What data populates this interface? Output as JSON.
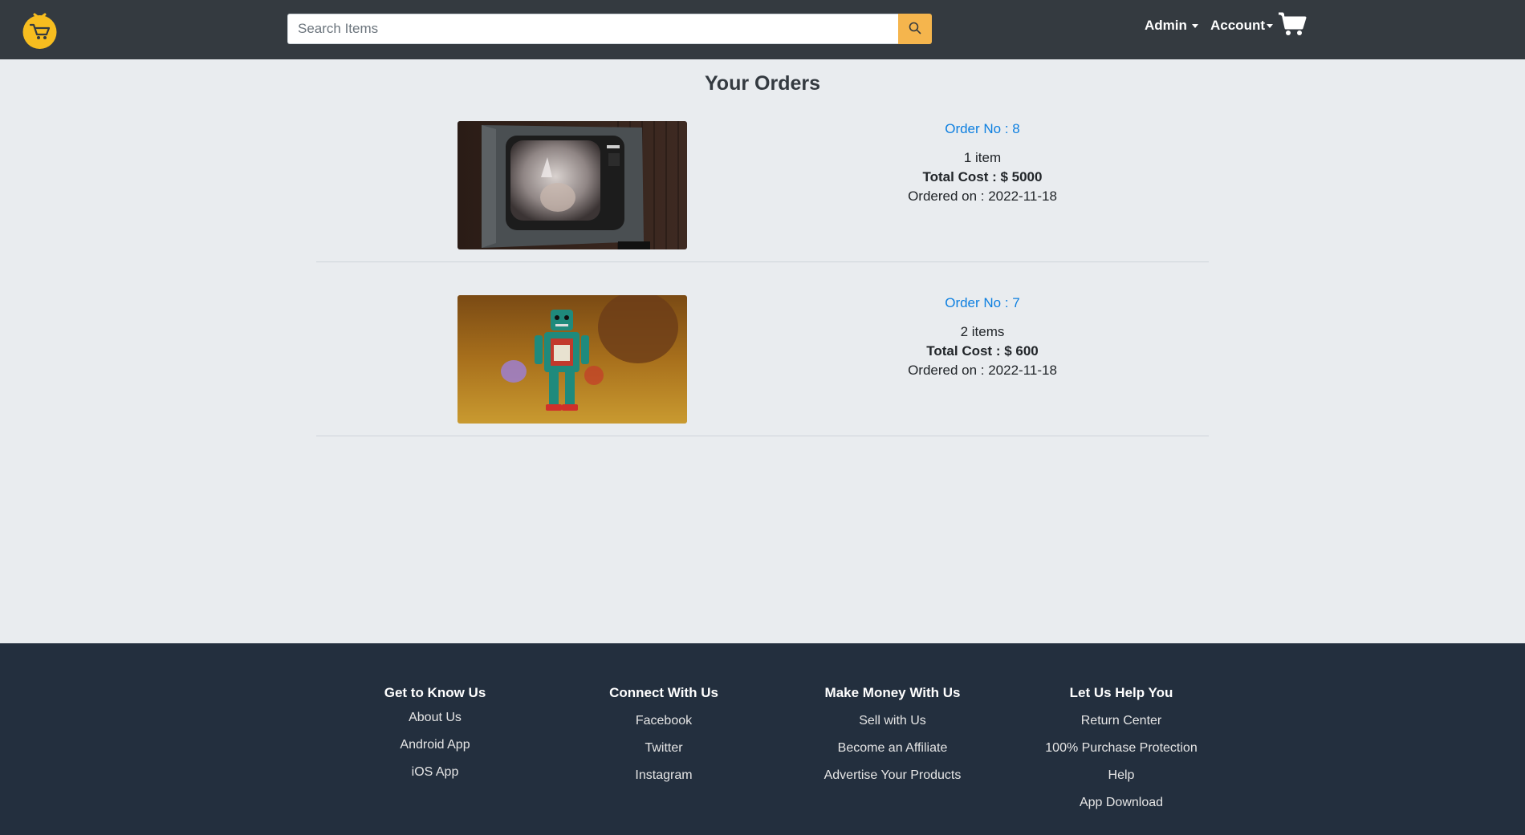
{
  "header": {
    "search": {
      "placeholder": "Search Items",
      "value": ""
    },
    "menus": [
      {
        "label": "Admin"
      },
      {
        "label": "Account"
      }
    ],
    "colors": {
      "bg": "#343a40",
      "search_button": "#f5b54d",
      "logo": "#f7bd1f"
    }
  },
  "main": {
    "title": "Your Orders",
    "orders": [
      {
        "number_label": "Order No : 8",
        "items_label": "1 item",
        "total_label": "Total Cost : $ 5000",
        "date_label": "Ordered on : 2022-11-18",
        "image": "vintage-tv-photo"
      },
      {
        "number_label": "Order No : 7",
        "items_label": "2 items",
        "total_label": "Total Cost : $ 600",
        "date_label": "Ordered on : 2022-11-18",
        "image": "toy-robot-photo"
      }
    ]
  },
  "footer": {
    "columns": [
      {
        "title": "Get to Know Us",
        "links": [
          "About Us",
          "Android App",
          "iOS App"
        ]
      },
      {
        "title": "Connect With Us",
        "links": [
          "Facebook",
          "Twitter",
          "Instagram"
        ]
      },
      {
        "title": "Make Money With Us",
        "links": [
          "Sell with Us",
          "Become an Affiliate",
          "Advertise Your Products"
        ]
      },
      {
        "title": "Let Us Help You",
        "links": [
          "Return Center",
          "100% Purchase Protection",
          "Help",
          "App Download"
        ]
      }
    ]
  }
}
